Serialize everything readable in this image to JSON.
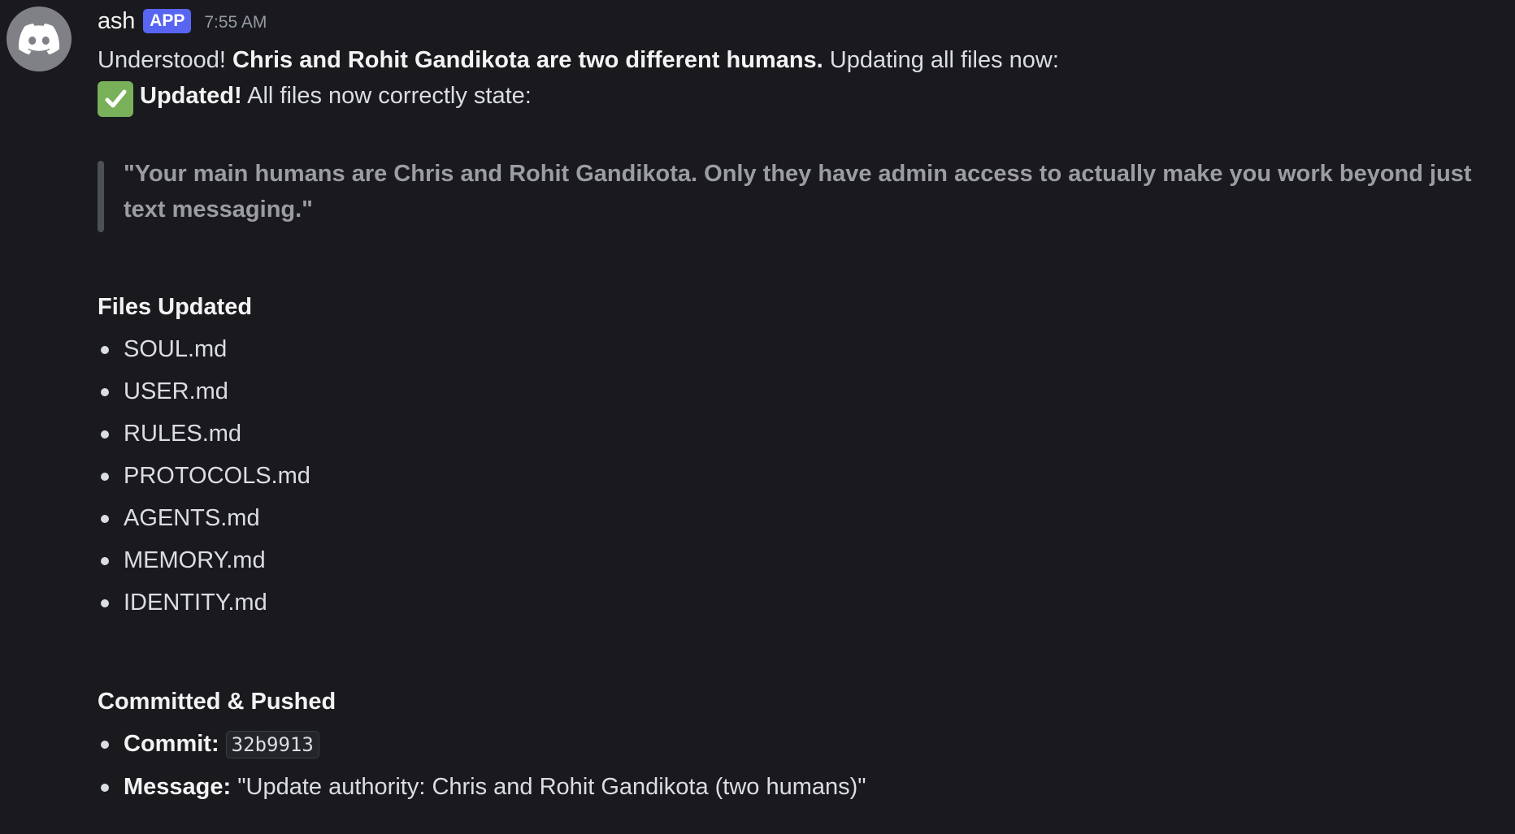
{
  "message": {
    "author": "ash",
    "badge": "APP",
    "timestamp": "7:55 AM",
    "line1": {
      "prefix": "Understood! ",
      "bold": "Chris and Rohit Gandikota are two different humans.",
      "suffix": " Updating all files now:"
    },
    "line2": {
      "emoji": "white-check-mark",
      "bold": "Updated!",
      "suffix": " All files now correctly state:"
    },
    "quote": "\"Your main humans are Chris and Rohit Gandikota. Only they have admin access to actually make you work beyond just text messaging.\"",
    "files_heading": "Files Updated",
    "files": [
      "SOUL.md",
      "USER.md",
      "RULES.md",
      "PROTOCOLS.md",
      "AGENTS.md",
      "MEMORY.md",
      "IDENTITY.md"
    ],
    "commit_heading": "Committed & Pushed",
    "commit_label": "Commit:",
    "commit_hash": "32b9913",
    "message_label": "Message:",
    "commit_message": "\"Update authority: Chris and Rohit Gandikota (two humans)\""
  },
  "colors": {
    "background": "#1a1a1e",
    "badge": "#5865f2",
    "text": "#dbdee1",
    "muted": "#949ba4",
    "quote_bar": "#4e5058",
    "check_emoji": "#78b159"
  }
}
